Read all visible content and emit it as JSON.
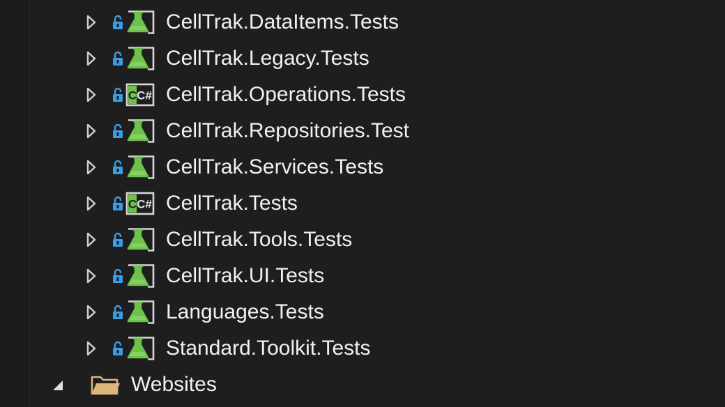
{
  "solution_explorer": {
    "projects": [
      {
        "name": "CellTrak.DataItems.Tests",
        "icon": "test-project-icon"
      },
      {
        "name": "CellTrak.Legacy.Tests",
        "icon": "test-project-icon"
      },
      {
        "name": "CellTrak.Operations.Tests",
        "icon": "csharp-project-icon"
      },
      {
        "name": "CellTrak.Repositories.Test",
        "icon": "test-project-icon"
      },
      {
        "name": "CellTrak.Services.Tests",
        "icon": "test-project-icon"
      },
      {
        "name": "CellTrak.Tests",
        "icon": "csharp-project-icon"
      },
      {
        "name": "CellTrak.Tools.Tests",
        "icon": "test-project-icon"
      },
      {
        "name": "CellTrak.UI.Tests",
        "icon": "test-project-icon"
      },
      {
        "name": "Languages.Tests",
        "icon": "test-project-icon"
      },
      {
        "name": "Standard.Toolkit.Tests",
        "icon": "test-project-icon"
      }
    ],
    "folder": {
      "name": "Websites",
      "icon": "folder-icon",
      "expanded": true
    },
    "csharp_badge": "C#"
  },
  "colors": {
    "background": "#1e1e1e",
    "text": "#f1f1f1",
    "lock_blue": "#3a9ee6",
    "test_green": "#6cc24a",
    "folder_tan": "#dcb67a",
    "expander": "#d0d0d0"
  }
}
